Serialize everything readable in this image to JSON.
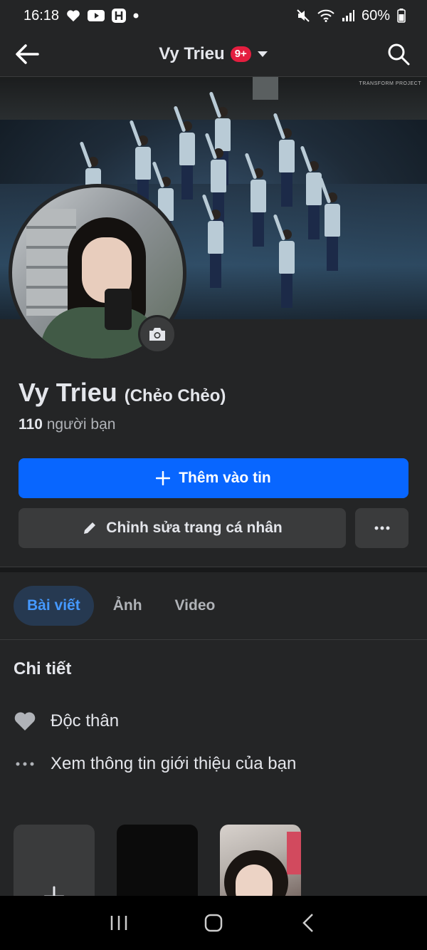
{
  "status_bar": {
    "time": "16:18",
    "battery": "60%"
  },
  "header": {
    "title": "Vy Trieu",
    "badge": "9+"
  },
  "cover": {
    "watermark": "TRANSFORM PROJECT"
  },
  "profile": {
    "name": "Vy Trieu",
    "nickname": "(Chẻo Chẻo)",
    "friends_count": "110",
    "friends_label": "người bạn"
  },
  "actions": {
    "add_story_label": "Thêm vào tin",
    "edit_profile_label": "Chỉnh sửa trang cá nhân"
  },
  "tabs": [
    {
      "label": "Bài viết",
      "active": true
    },
    {
      "label": "Ảnh",
      "active": false
    },
    {
      "label": "Video",
      "active": false
    }
  ],
  "details": {
    "title": "Chi tiết",
    "relationship": "Độc thân",
    "see_about": "Xem thông tin giới thiệu của bạn"
  },
  "colors": {
    "background": "#242526",
    "primary_blue": "#0866ff",
    "active_tab_text": "#4599ff",
    "badge_red": "#e41e3f"
  }
}
